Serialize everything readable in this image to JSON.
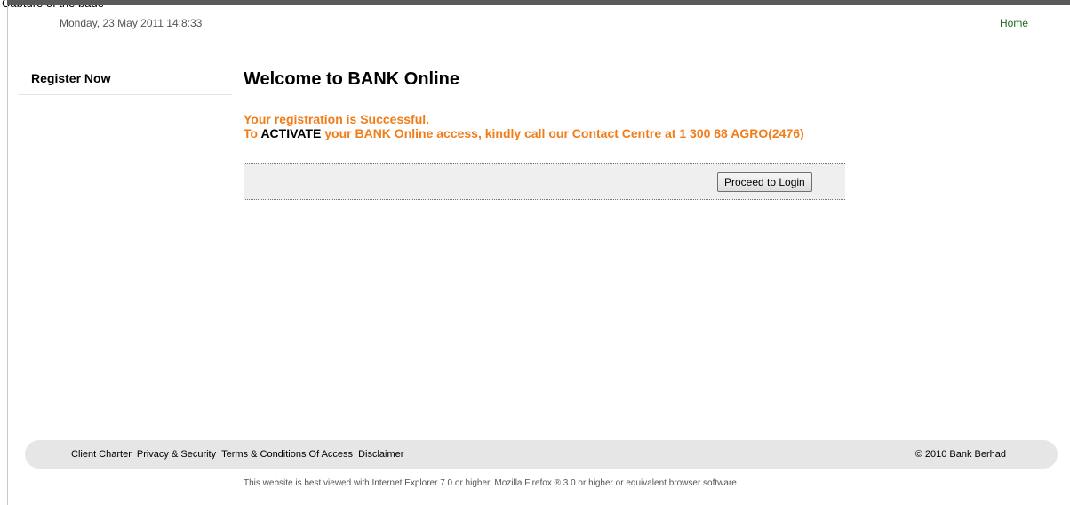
{
  "caption": "Capture of the page",
  "header": {
    "date": "Monday, 23 May 2011 14:8:33",
    "home_link": "Home"
  },
  "sidebar": {
    "title": "Register Now"
  },
  "main": {
    "title": "Welcome to BANK Online",
    "success_message": "Your registration is Successful.",
    "activate_prefix": "To ",
    "activate_word": "ACTIVATE",
    "activate_suffix": " your BANK Online access, kindly call our Contact Centre at 1 300 88 AGRO(2476)",
    "proceed_button": "Proceed to Login"
  },
  "footer": {
    "links": [
      "Client Charter",
      "Privacy & Security",
      "Terms & Conditions Of Access",
      "Disclaimer"
    ],
    "copyright": "© 2010 Bank Berhad",
    "browser_note": "This website is best viewed with Internet Explorer 7.0 or higher, Mozilla Firefox ® 3.0 or higher or equivalent browser software."
  },
  "colors": {
    "accent_orange": "#f07d1a",
    "home_link_green": "#1e6b1e",
    "footer_bg": "#e6e6e6"
  }
}
